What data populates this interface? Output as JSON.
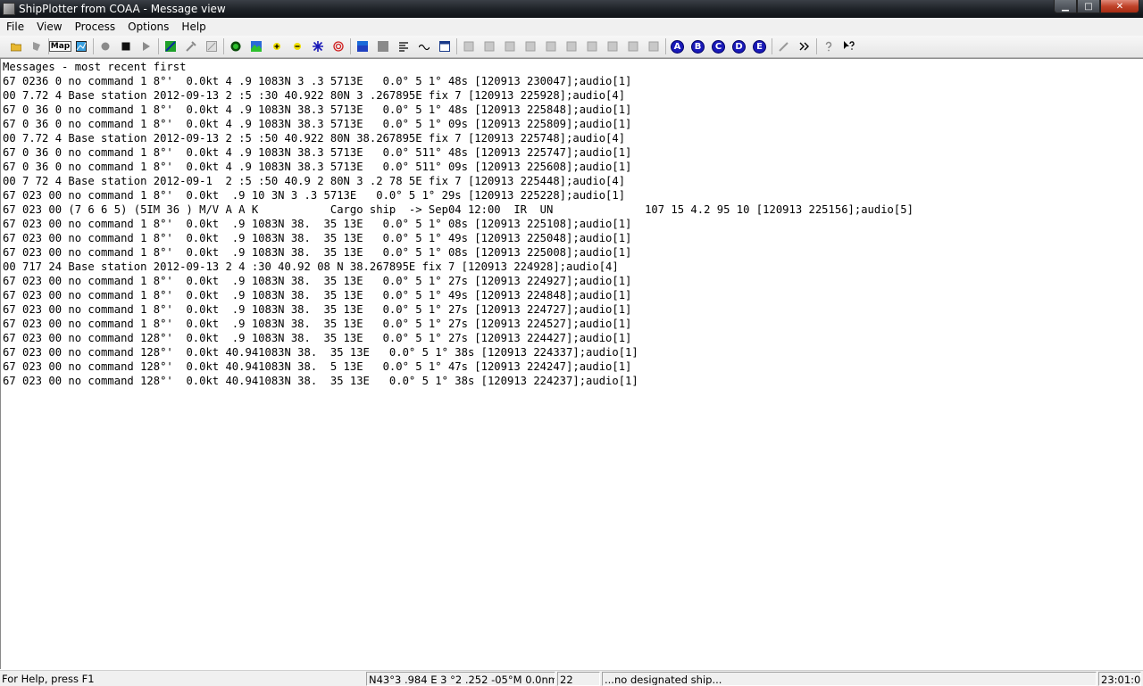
{
  "window": {
    "title": "ShipPlotter from COAA - Message view",
    "minimize_glyph": "▁",
    "maximize_glyph": "□",
    "close_glyph": "✕"
  },
  "menu": [
    "File",
    "View",
    "Process",
    "Options",
    "Help"
  ],
  "toolbar": {
    "map_label": "Map",
    "letters": [
      "A",
      "B",
      "C",
      "D",
      "E"
    ]
  },
  "messages": {
    "header": "Messages - most recent first",
    "lines": [
      "67 0236 0 no command 1 8°'  0.0kt 4 .9 1083N 3 .3 5713E   0.0° 5 1° 48s [120913 230047];audio[1]",
      "00 7.72 4 Base station 2012-09-13 2 :5 :30 40.922 80N 3 .267895E fix 7 [120913 225928];audio[4]",
      "67 0 36 0 no command 1 8°'  0.0kt 4 .9 1083N 38.3 5713E   0.0° 5 1° 48s [120913 225848];audio[1]",
      "67 0 36 0 no command 1 8°'  0.0kt 4 .9 1083N 38.3 5713E   0.0° 5 1° 09s [120913 225809];audio[1]",
      "00 7.72 4 Base station 2012-09-13 2 :5 :50 40.922 80N 38.267895E fix 7 [120913 225748];audio[4]",
      "67 0 36 0 no command 1 8°'  0.0kt 4 .9 1083N 38.3 5713E   0.0° 511° 48s [120913 225747];audio[1]",
      "67 0 36 0 no command 1 8°'  0.0kt 4 .9 1083N 38.3 5713E   0.0° 511° 09s [120913 225608];audio[1]",
      "00 7 72 4 Base station 2012-09-1  2 :5 :50 40.9 2 80N 3 .2 78 5E fix 7 [120913 225448];audio[4]",
      "67 023 00 no command 1 8°'  0.0kt  .9 10 3N 3 .3 5713E   0.0° 5 1° 29s [120913 225228];audio[1]",
      "67 023 00 (7 6 6 5) (5IM 36 ) M/V A A K           Cargo ship  -> Sep04 12:00  IR  UN              107 15 4.2 95 10 [120913 225156];audio[5]",
      "67 023 00 no command 1 8°'  0.0kt  .9 1083N 38.  35 13E   0.0° 5 1° 08s [120913 225108];audio[1]",
      "67 023 00 no command 1 8°'  0.0kt  .9 1083N 38.  35 13E   0.0° 5 1° 49s [120913 225048];audio[1]",
      "67 023 00 no command 1 8°'  0.0kt  .9 1083N 38.  35 13E   0.0° 5 1° 08s [120913 225008];audio[1]",
      "00 717 24 Base station 2012-09-13 2 4 :30 40.92 08 N 38.267895E fix 7 [120913 224928];audio[4]",
      "67 023 00 no command 1 8°'  0.0kt  .9 1083N 38.  35 13E   0.0° 5 1° 27s [120913 224927];audio[1]",
      "67 023 00 no command 1 8°'  0.0kt  .9 1083N 38.  35 13E   0.0° 5 1° 49s [120913 224848];audio[1]",
      "67 023 00 no command 1 8°'  0.0kt  .9 1083N 38.  35 13E   0.0° 5 1° 27s [120913 224727];audio[1]",
      "67 023 00 no command 1 8°'  0.0kt  .9 1083N 38.  35 13E   0.0° 5 1° 27s [120913 224527];audio[1]",
      "67 023 00 no command 128°'  0.0kt  .9 1083N 38.  35 13E   0.0° 5 1° 27s [120913 224427];audio[1]",
      "67 023 00 no command 128°'  0.0kt 40.941083N 38.  35 13E   0.0° 5 1° 38s [120913 224337];audio[1]",
      "67 023 00 no command 128°'  0.0kt 40.941083N 38.  5 13E   0.0° 5 1° 47s [120913 224247];audio[1]",
      "67 023 00 no command 128°'  0.0kt 40.941083N 38.  35 13E   0.0° 5 1° 38s [120913 224237];audio[1]"
    ]
  },
  "status": {
    "help": "For Help, press F1",
    "position": "N43°3 .984 E 3 °2 .252 -05°M 0.0nm",
    "count": "22",
    "ship": "...no designated ship...",
    "clock": "23:01:03"
  }
}
